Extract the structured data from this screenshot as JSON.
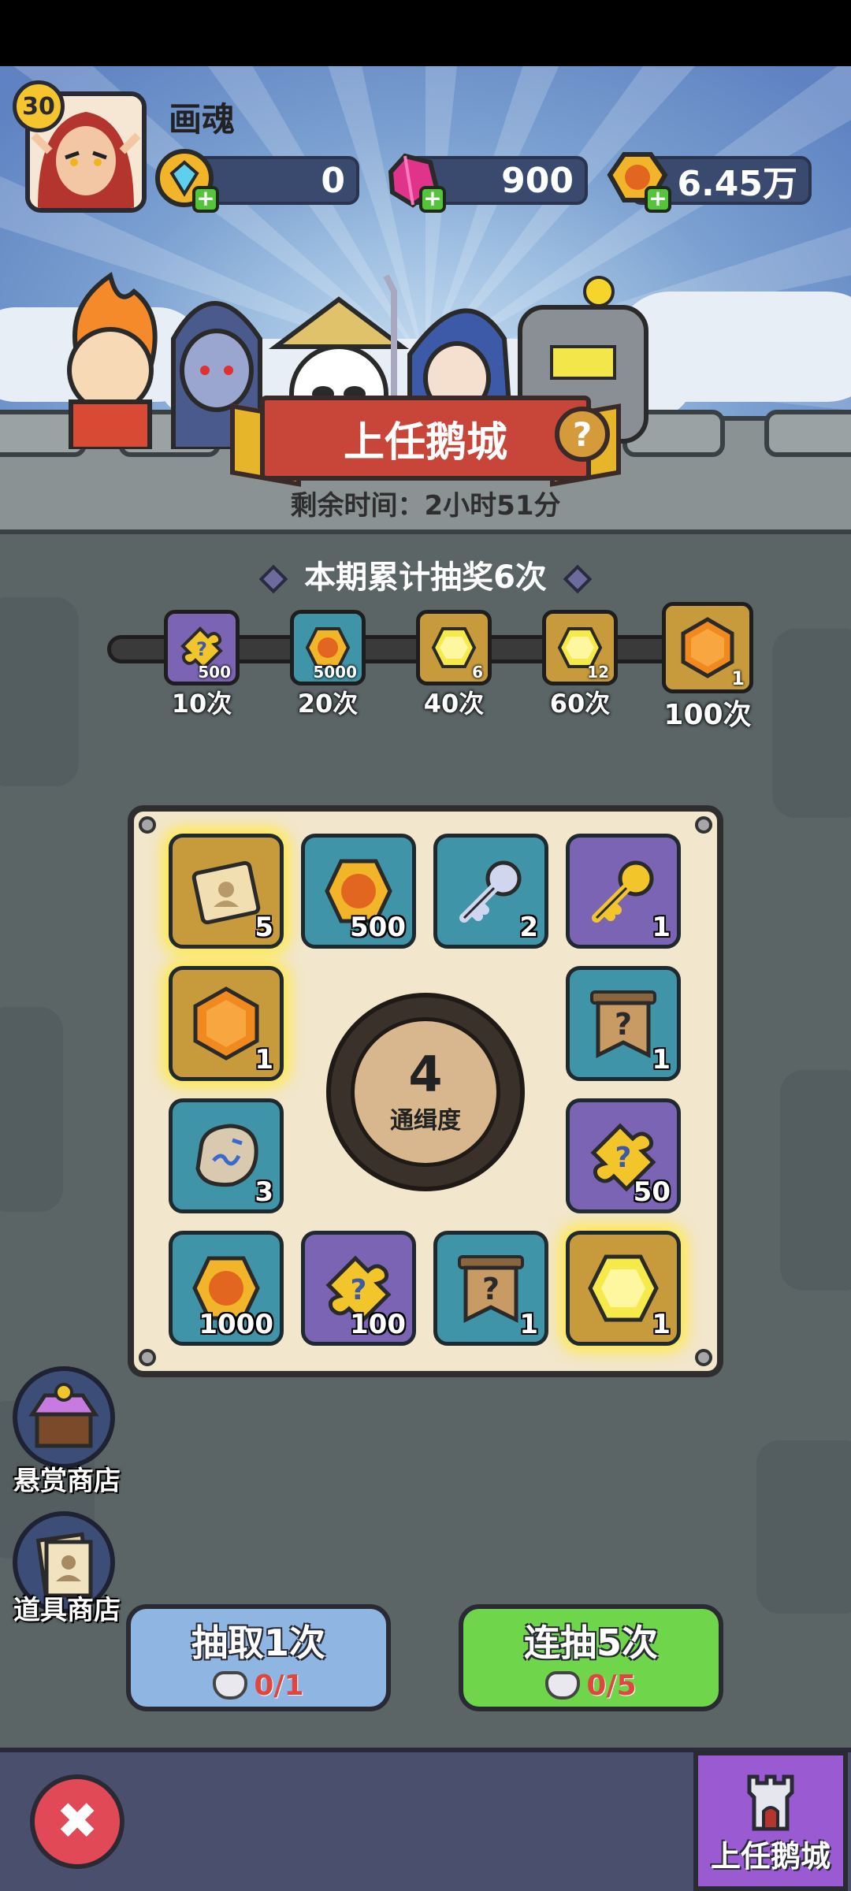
{
  "player": {
    "level": "30",
    "name": "画魂"
  },
  "resources": [
    {
      "icon": "blue-gem-icon",
      "value": "0"
    },
    {
      "icon": "pink-crystal-icon",
      "value": "900"
    },
    {
      "icon": "gold-coin-icon",
      "value": "6.45万"
    }
  ],
  "event": {
    "title": "上任鹅城",
    "help": "?",
    "remaining": "剩余时间：2小时51分"
  },
  "progress": {
    "title": "本期累计抽奖6次",
    "milestones": [
      {
        "icon": "puzzle-piece-icon",
        "amount": "500",
        "label": "10次"
      },
      {
        "icon": "gold-coin-icon",
        "amount": "5000",
        "label": "20次"
      },
      {
        "icon": "yellow-gem-icon",
        "amount": "6",
        "label": "40次"
      },
      {
        "icon": "yellow-gem-icon",
        "amount": "12",
        "label": "60次"
      },
      {
        "icon": "orange-gem-icon",
        "amount": "1",
        "label": "100次"
      }
    ]
  },
  "board": {
    "cells": [
      {
        "icon": "scroll-icon",
        "qty": "5"
      },
      {
        "icon": "gold-coin-icon",
        "qty": "500"
      },
      {
        "icon": "silver-key-icon",
        "qty": "2"
      },
      {
        "icon": "gold-key-icon",
        "qty": "1"
      },
      {
        "icon": "orange-gem-icon",
        "qty": "1"
      },
      {
        "icon": "mystery-banner-icon",
        "qty": "1"
      },
      {
        "icon": "rune-stone-icon",
        "qty": "3"
      },
      {
        "icon": "puzzle-piece-icon",
        "qty": "50"
      },
      {
        "icon": "gold-coin-icon",
        "qty": "1000"
      },
      {
        "icon": "puzzle-piece-icon",
        "qty": "100"
      },
      {
        "icon": "mystery-banner-icon",
        "qty": "1"
      },
      {
        "icon": "yellow-gem-icon",
        "qty": "1"
      }
    ],
    "dial": {
      "value": "4",
      "label": "通缉度"
    }
  },
  "shops": [
    {
      "icon": "bounty-shop-icon",
      "label": "悬赏商店"
    },
    {
      "icon": "item-shop-icon",
      "label": "道具商店"
    }
  ],
  "actions": {
    "single": {
      "label": "抽取1次",
      "cost": "0/1"
    },
    "multi": {
      "label": "连抽5次",
      "cost": "0/5"
    }
  },
  "footer": {
    "close": "✖",
    "tab": "上任鹅城"
  },
  "colors": {
    "accent_red": "#c8453a",
    "green": "#6fd64c",
    "blue": "#8fb6e2",
    "purple": "#9a5ad2"
  }
}
